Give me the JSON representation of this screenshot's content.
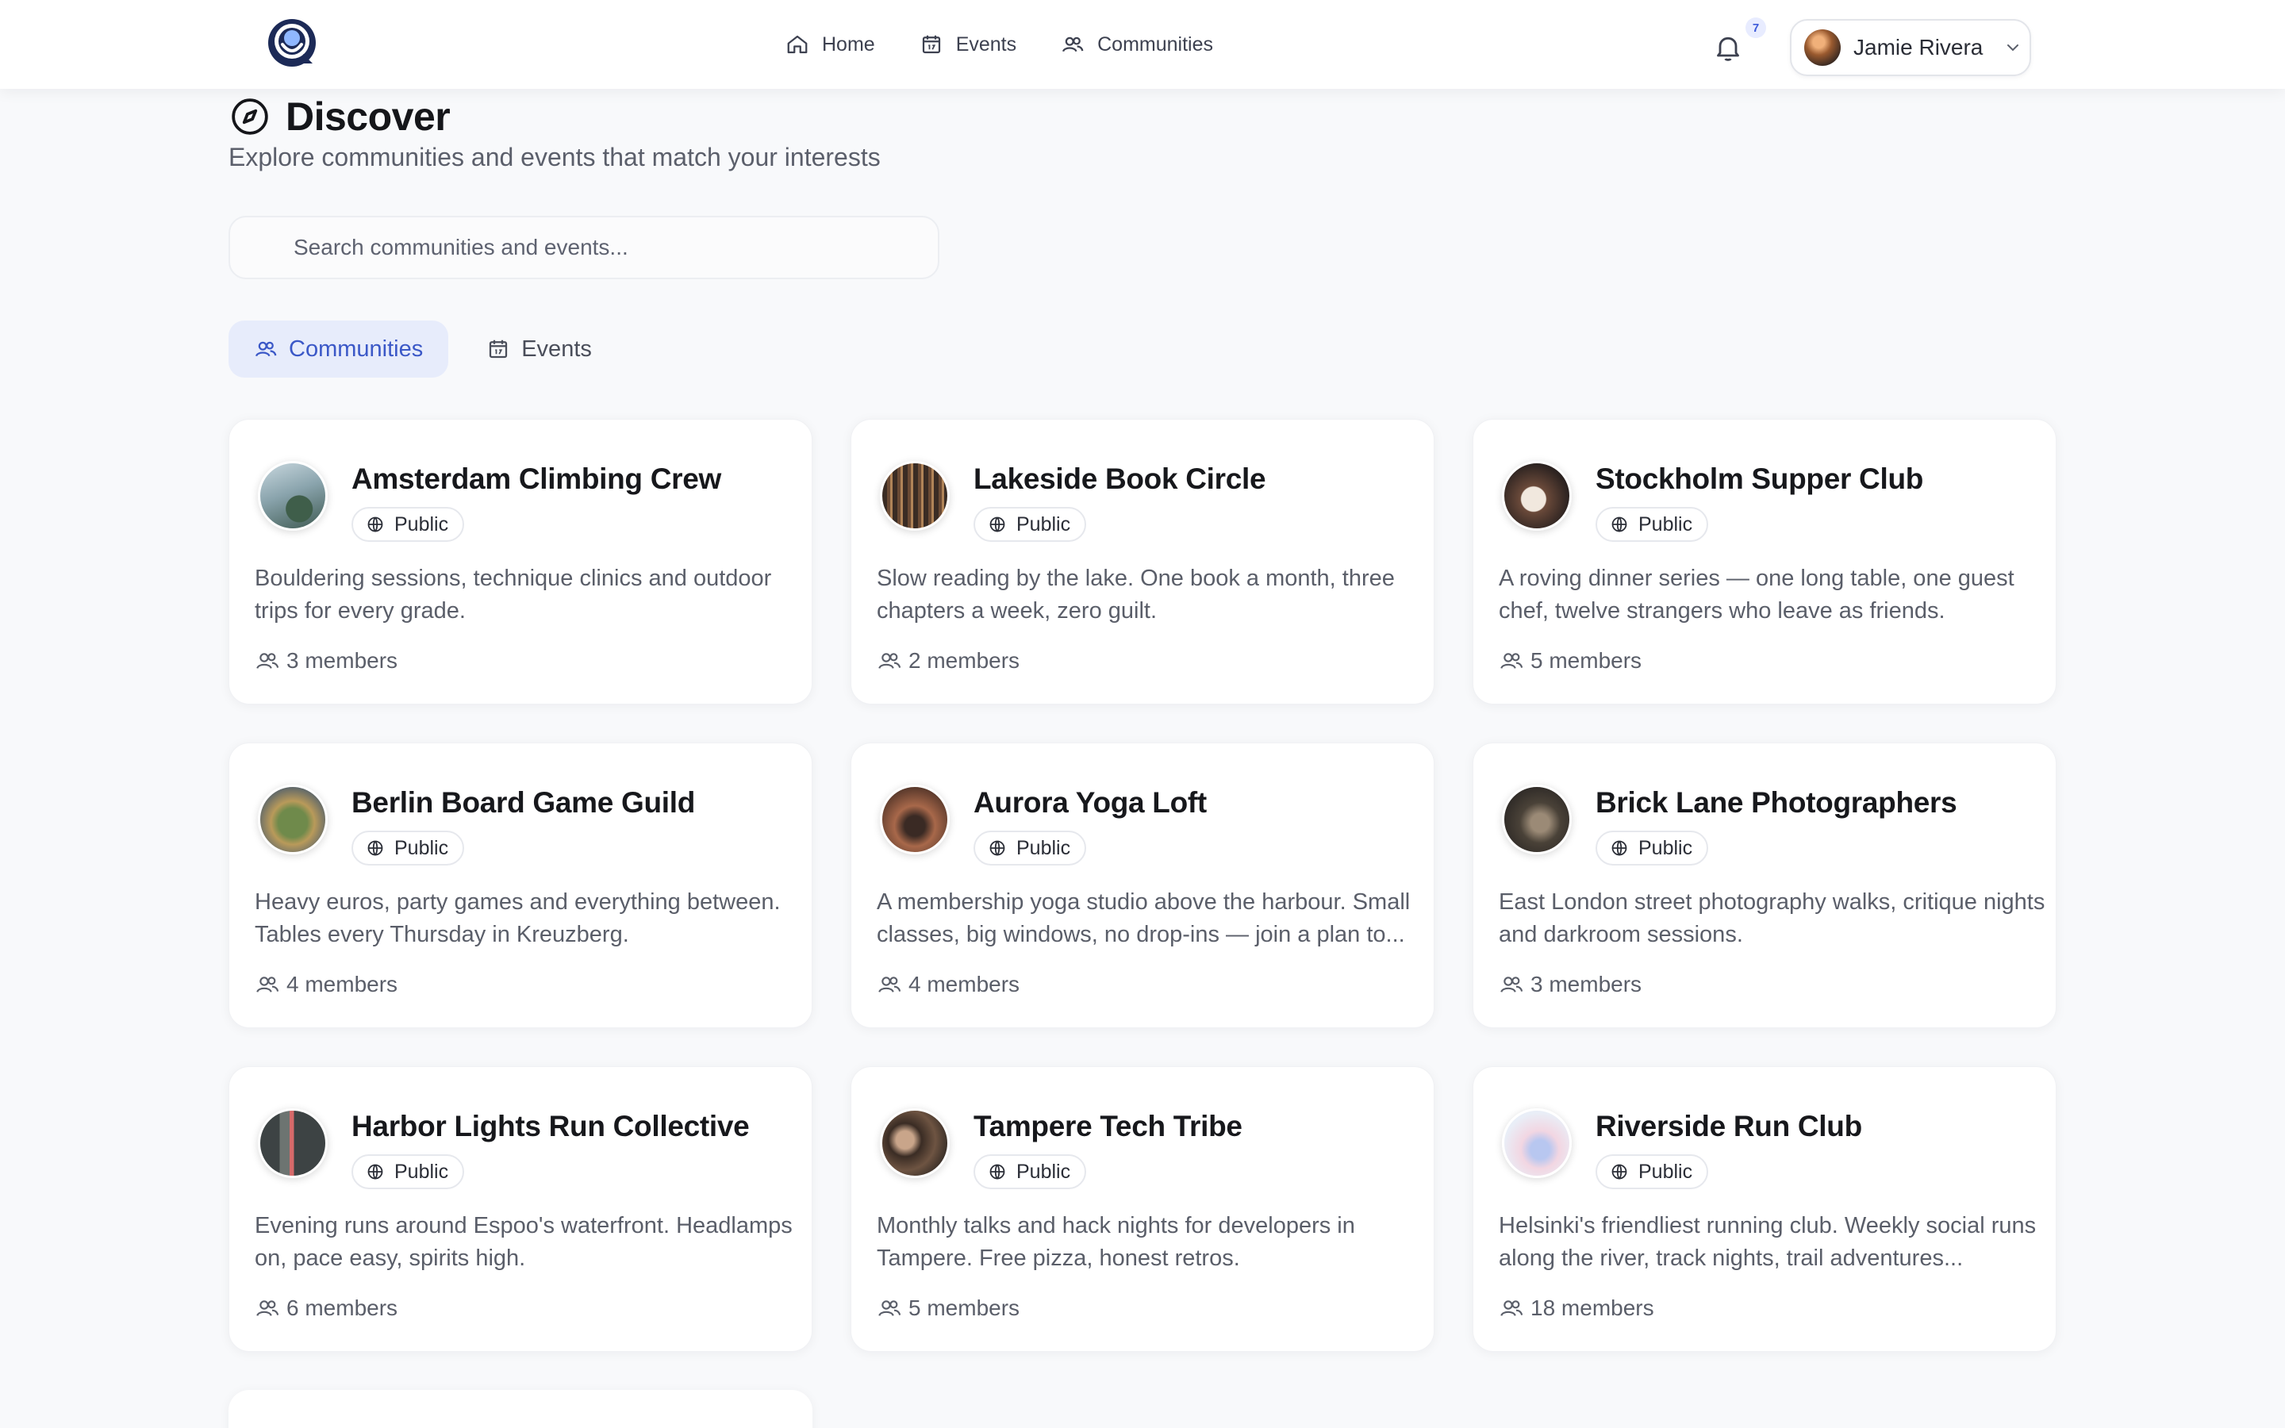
{
  "header": {
    "nav": [
      {
        "label": "Home",
        "icon": "home-icon"
      },
      {
        "label": "Events",
        "icon": "calendar-icon"
      },
      {
        "label": "Communities",
        "icon": "users-icon"
      }
    ],
    "notifications_count": "7",
    "user_name": "Jamie Rivera"
  },
  "page": {
    "title": "Discover",
    "subtitle": "Explore communities and events that match your interests",
    "search_placeholder": "Search communities and events..."
  },
  "tabs": [
    {
      "label": "Communities",
      "active": true,
      "icon": "users-icon"
    },
    {
      "label": "Events",
      "active": false,
      "icon": "calendar-icon"
    }
  ],
  "communities": [
    {
      "name": "Amsterdam Climbing Crew",
      "visibility": "Public",
      "description": "Bouldering sessions, technique clinics and outdoor trips for every grade.",
      "members": "3 members"
    },
    {
      "name": "Lakeside Book Circle",
      "visibility": "Public",
      "description": "Slow reading by the lake. One book a month, three chapters a week, zero guilt.",
      "members": "2 members"
    },
    {
      "name": "Stockholm Supper Club",
      "visibility": "Public",
      "description": "A roving dinner series — one long table, one guest chef, twelve strangers who leave as friends.",
      "members": "5 members"
    },
    {
      "name": "Berlin Board Game Guild",
      "visibility": "Public",
      "description": "Heavy euros, party games and everything between. Tables every Thursday in Kreuzberg.",
      "members": "4 members"
    },
    {
      "name": "Aurora Yoga Loft",
      "visibility": "Public",
      "description": "A membership yoga studio above the harbour. Small classes, big windows, no drop-ins — join a plan to...",
      "members": "4 members"
    },
    {
      "name": "Brick Lane Photographers",
      "visibility": "Public",
      "description": "East London street photography walks, critique nights and darkroom sessions.",
      "members": "3 members"
    },
    {
      "name": "Harbor Lights Run Collective",
      "visibility": "Public",
      "description": "Evening runs around Espoo's waterfront. Headlamps on, pace easy, spirits high.",
      "members": "6 members"
    },
    {
      "name": "Tampere Tech Tribe",
      "visibility": "Public",
      "description": "Monthly talks and hack nights for developers in Tampere. Free pizza, honest retros.",
      "members": "5 members"
    },
    {
      "name": "Riverside Run Club",
      "visibility": "Public",
      "description": "Helsinki's friendliest running club. Weekly social runs along the river, track nights, trail adventures...",
      "members": "18 members"
    }
  ]
}
